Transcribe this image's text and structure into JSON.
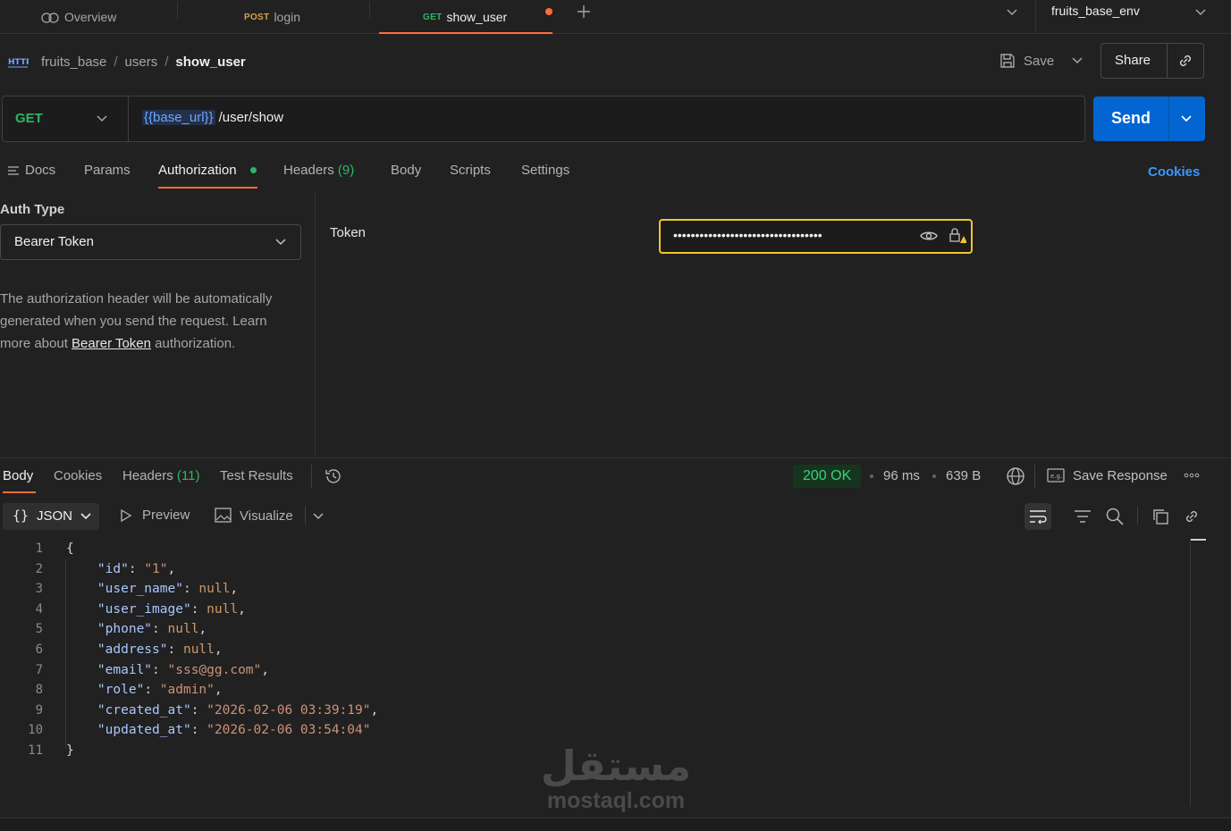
{
  "tabs": [
    {
      "label": "Overview",
      "method": ""
    },
    {
      "label": "login",
      "method": "POST"
    },
    {
      "label": "show_user",
      "method": "GET"
    }
  ],
  "environment": "fruits_base_env",
  "breadcrumb": {
    "collection": "fruits_base",
    "folder": "users",
    "request": "show_user"
  },
  "actions": {
    "save": "Save",
    "share": "Share"
  },
  "request": {
    "method": "GET",
    "url_variable": "{{base_url}}",
    "url_path": "/user/show",
    "send": "Send"
  },
  "request_tabs": {
    "docs": "Docs",
    "params": "Params",
    "authorization": "Authorization",
    "headers": "Headers",
    "headers_count": "(9)",
    "body": "Body",
    "scripts": "Scripts",
    "settings": "Settings",
    "cookies": "Cookies"
  },
  "auth": {
    "type_label": "Auth Type",
    "type_value": "Bearer Token",
    "desc_1": "The authorization header will be automatically",
    "desc_2": "generated when you send the request. Learn",
    "desc_3_pre": "more about ",
    "desc_link": "Bearer Token",
    "desc_3_post": " authorization.",
    "token_label": "Token",
    "token_masked": "••••••••••••••••••••••••••••••••••"
  },
  "response": {
    "tabs": {
      "body": "Body",
      "cookies": "Cookies",
      "headers": "Headers",
      "headers_count": "(11)",
      "tests": "Test Results"
    },
    "status": "200 OK",
    "time": "96 ms",
    "size": "639 B",
    "save_response": "Save Response",
    "format": "JSON",
    "preview": "Preview",
    "visualize": "Visualize",
    "line_numbers": [
      "1",
      "2",
      "3",
      "4",
      "5",
      "6",
      "7",
      "8",
      "9",
      "10",
      "11"
    ],
    "json_lines": [
      {
        "indent": "",
        "key": "",
        "value": "",
        "raw": "{"
      },
      {
        "indent": "    ",
        "key": "\"id\"",
        "value": "\"1\"",
        "type": "s",
        "comma": ","
      },
      {
        "indent": "    ",
        "key": "\"user_name\"",
        "value": "null",
        "type": "n",
        "comma": ","
      },
      {
        "indent": "    ",
        "key": "\"user_image\"",
        "value": "null",
        "type": "n",
        "comma": ","
      },
      {
        "indent": "    ",
        "key": "\"phone\"",
        "value": "null",
        "type": "n",
        "comma": ","
      },
      {
        "indent": "    ",
        "key": "\"address\"",
        "value": "null",
        "type": "n",
        "comma": ","
      },
      {
        "indent": "    ",
        "key": "\"email\"",
        "value": "\"sss@gg.com\"",
        "type": "s",
        "comma": ","
      },
      {
        "indent": "    ",
        "key": "\"role\"",
        "value": "\"admin\"",
        "type": "s",
        "comma": ","
      },
      {
        "indent": "    ",
        "key": "\"created_at\"",
        "value": "\"2026-02-06 03:39:19\"",
        "type": "s",
        "comma": ","
      },
      {
        "indent": "    ",
        "key": "\"updated_at\"",
        "value": "\"2026-02-06 03:54:04\"",
        "type": "s",
        "comma": ""
      },
      {
        "indent": "",
        "key": "",
        "value": "",
        "raw": "}"
      }
    ]
  },
  "watermark": {
    "arabic": "مستقل",
    "latin": "mostaql.com"
  },
  "colors": {
    "accent": "#ff6c37",
    "send": "#0265d2",
    "status_ok": "#3bd07a",
    "token_border": "#f6c52b",
    "cookies_link": "#3d96ff",
    "get": "#29b866"
  }
}
